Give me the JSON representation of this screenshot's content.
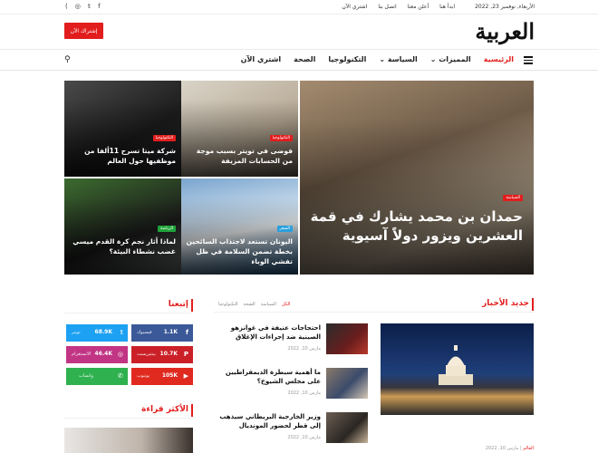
{
  "topbar": {
    "date": "الأربعاء, نوفمبر 23, 2022",
    "links": [
      "ابدأ هنا",
      "أعلن معنا",
      "اتصل بنا",
      "اشتري الآن"
    ],
    "social_icons": [
      "facebook-icon",
      "twitter-icon",
      "instagram-icon",
      "rss-icon"
    ]
  },
  "header": {
    "logo": "العربية",
    "subscribe_label": "إشتراك الآن"
  },
  "nav": {
    "items": [
      {
        "label": "الرئيسية",
        "active": true
      },
      {
        "label": "المميزات ⌄",
        "active": false
      },
      {
        "label": "السياسة ⌄",
        "active": false
      },
      {
        "label": "التكنولوجيا",
        "active": false
      },
      {
        "label": "الصحة",
        "active": false
      },
      {
        "label": "اشتري الآن",
        "active": false
      }
    ]
  },
  "hero": {
    "main": {
      "category": "السياسة",
      "title": "حمدان بن محمد يشارك في قمة العشرين ويزور دولاً آسيوية"
    },
    "tiles": [
      {
        "category": "التكنولوجيا",
        "title": "فوضى في تويتر بسبب موجة من الحسابات المزيفة"
      },
      {
        "category": "التكنولوجيا",
        "title": "شركة ميتا تسرح 11ألفا من موظفيها حول العالم"
      },
      {
        "category": "السفر",
        "title": "اليونان تستعد لاجتذاب السائحين بخطة تضمن السلامة في ظل تفشي الوباء"
      },
      {
        "category": "الرياضة",
        "title": "لماذا أثار نجم كرة القدم ميسي غضب نشطاء البيئة؟"
      }
    ]
  },
  "latest_news": {
    "heading": "جديد الأخبار",
    "tabs": [
      "الكل",
      "السياسة",
      "الصحة",
      "التكنولوجيا"
    ],
    "featured": {
      "category": "العالم",
      "date": "مارس 10, 2022"
    },
    "items": [
      {
        "title": "احتجاجات عنيفة في غوانزهو الصينية ضد إجراءات الإغلاق",
        "date": "مارس 10, 2022"
      },
      {
        "title": "ما أهمية سيطرة الديمقراطيين على مجلس الشيوخ؟",
        "date": "مارس 10, 2022"
      },
      {
        "title": "وزير الخارجية البريطاني سيذهب إلى قطر لحضور المونديال",
        "date": "مارس 10, 2022"
      }
    ]
  },
  "follow": {
    "heading": "إتبعنا",
    "networks": [
      {
        "count": "1.1K",
        "label": "فيسبوك",
        "icon": "facebook-icon",
        "color": "#3b5998"
      },
      {
        "count": "68.9K",
        "label": "تويتر",
        "icon": "twitter-icon",
        "color": "#1da1f2"
      },
      {
        "count": "10.7K",
        "label": "بينتيريست",
        "icon": "pinterest-icon",
        "color": "#cb2027"
      },
      {
        "count": "46.4K",
        "label": "الانستغرام",
        "icon": "instagram-icon",
        "color": "#c13584"
      },
      {
        "count": "105K",
        "label": "يوتيوب",
        "icon": "youtube-icon",
        "color": "#e02a20"
      },
      {
        "count": "",
        "label": "واتساب",
        "icon": "whatsapp-icon",
        "color": "#2fb14f"
      }
    ]
  },
  "most_read": {
    "heading": "الأكثر قراءة"
  }
}
